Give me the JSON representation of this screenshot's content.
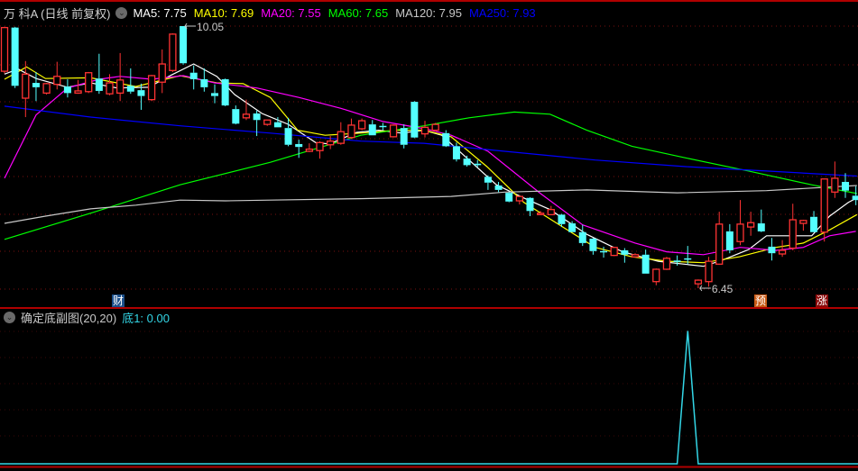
{
  "header": {
    "title": "万 科A (日线 前复权)",
    "ma_items": [
      {
        "label": "MA5: 7.75",
        "color": "#ffffff"
      },
      {
        "label": "MA10: 7.69",
        "color": "#ffff00"
      },
      {
        "label": "MA20: 7.55",
        "color": "#ff00ff"
      },
      {
        "label": "MA60: 7.65",
        "color": "#00ff00"
      },
      {
        "label": "MA120: 7.95",
        "color": "#c8c8c8"
      },
      {
        "label": "MA250: 7.93",
        "color": "#0000ff"
      }
    ]
  },
  "markers": {
    "cai": "财",
    "yu": "预",
    "zhang": "涨"
  },
  "subchart": {
    "title": "确定底副图(20,20)",
    "value_label": "底1: 0.00"
  },
  "chart_data": {
    "type": "candlestick",
    "title": "万科A 日线 前复权",
    "ylim": [
      6.3,
      10.15
    ],
    "up_color": "#ff3333",
    "down_color": "#54ffff",
    "high_label": "10.05",
    "low_label": "6.45",
    "high_index": 17,
    "low_index": 66,
    "candles_ochl": [
      [
        9.43,
        10.03,
        10.04,
        9.4
      ],
      [
        10.03,
        9.23,
        10.04,
        9.2
      ],
      [
        9.06,
        9.39,
        9.57,
        8.8
      ],
      [
        9.27,
        9.21,
        9.42,
        9.02
      ],
      [
        9.13,
        9.26,
        9.27,
        9.11
      ],
      [
        9.25,
        9.36,
        9.56,
        9.18
      ],
      [
        9.22,
        9.13,
        9.32,
        9.07
      ],
      [
        9.13,
        9.16,
        9.31,
        9.12
      ],
      [
        9.15,
        9.41,
        9.42,
        9.13
      ],
      [
        9.33,
        9.16,
        9.67,
        9.12
      ],
      [
        9.12,
        9.27,
        9.39,
        9.1
      ],
      [
        9.13,
        9.31,
        9.68,
        9.02
      ],
      [
        9.23,
        9.15,
        9.47,
        9.12
      ],
      [
        9.17,
        9.09,
        9.26,
        8.9
      ],
      [
        9.04,
        9.37,
        9.38,
        9.02
      ],
      [
        9.28,
        9.53,
        9.73,
        9.13
      ],
      [
        9.44,
        9.94,
        9.95,
        9.42
      ],
      [
        10.05,
        9.54,
        10.05,
        9.52
      ],
      [
        9.41,
        9.32,
        9.51,
        9.18
      ],
      [
        9.32,
        9.21,
        9.47,
        9.15
      ],
      [
        9.13,
        9.09,
        9.25,
        8.99
      ],
      [
        9.32,
        8.96,
        9.33,
        8.95
      ],
      [
        8.91,
        8.71,
        8.96,
        8.7
      ],
      [
        8.79,
        8.84,
        9.04,
        8.76
      ],
      [
        8.85,
        8.76,
        8.89,
        8.54
      ],
      [
        8.7,
        8.76,
        8.76,
        8.68
      ],
      [
        8.73,
        8.66,
        8.8,
        8.66
      ],
      [
        8.65,
        8.42,
        8.79,
        8.4
      ],
      [
        8.43,
        8.39,
        8.49,
        8.24
      ],
      [
        8.33,
        8.36,
        8.44,
        8.32
      ],
      [
        8.34,
        8.45,
        8.47,
        8.23
      ],
      [
        8.42,
        8.47,
        8.54,
        8.36
      ],
      [
        8.44,
        8.6,
        8.73,
        8.42
      ],
      [
        8.52,
        8.69,
        8.78,
        8.5
      ],
      [
        8.64,
        8.75,
        8.78,
        8.62
      ],
      [
        8.7,
        8.55,
        8.76,
        8.55
      ],
      [
        8.68,
        8.67,
        8.72,
        8.62
      ],
      [
        8.53,
        8.69,
        8.7,
        8.52
      ],
      [
        8.65,
        8.42,
        8.7,
        8.37
      ],
      [
        9.01,
        8.52,
        9.02,
        8.51
      ],
      [
        8.57,
        8.66,
        8.75,
        8.52
      ],
      [
        8.62,
        8.7,
        8.72,
        8.6
      ],
      [
        8.58,
        8.4,
        8.62,
        8.39
      ],
      [
        8.4,
        8.22,
        8.45,
        8.19
      ],
      [
        8.23,
        8.14,
        8.27,
        8.12
      ],
      [
        8.16,
        8.14,
        8.21,
        8.11
      ],
      [
        7.98,
        7.9,
        8.0,
        7.8
      ],
      [
        7.86,
        7.8,
        7.91,
        7.77
      ],
      [
        7.76,
        7.64,
        7.77,
        7.63
      ],
      [
        7.65,
        7.71,
        7.72,
        7.6
      ],
      [
        7.69,
        7.51,
        7.7,
        7.44
      ],
      [
        7.46,
        7.48,
        7.51,
        7.46
      ],
      [
        7.46,
        7.53,
        7.58,
        7.46
      ],
      [
        7.46,
        7.33,
        7.47,
        7.29
      ],
      [
        7.34,
        7.22,
        7.37,
        7.22
      ],
      [
        7.22,
        7.07,
        7.32,
        7.03
      ],
      [
        7.13,
        6.96,
        7.14,
        6.91
      ],
      [
        6.96,
        6.95,
        7.02,
        6.87
      ],
      [
        6.9,
        7.01,
        7.02,
        6.89
      ],
      [
        6.97,
        6.91,
        7.0,
        6.8
      ],
      [
        6.88,
        6.91,
        6.93,
        6.87
      ],
      [
        6.91,
        6.65,
        6.98,
        6.65
      ],
      [
        6.54,
        6.71,
        6.72,
        6.49
      ],
      [
        6.71,
        6.86,
        6.88,
        6.7
      ],
      [
        6.83,
        6.81,
        6.9,
        6.76
      ],
      [
        6.86,
        6.85,
        7.03,
        6.78
      ],
      [
        6.51,
        6.56,
        6.57,
        6.45
      ],
      [
        6.54,
        6.82,
        6.88,
        6.47
      ],
      [
        6.78,
        7.33,
        7.5,
        6.77
      ],
      [
        7.23,
        6.97,
        7.33,
        6.93
      ],
      [
        7.09,
        7.33,
        7.66,
        7.04
      ],
      [
        7.29,
        7.35,
        7.5,
        7.17
      ],
      [
        7.34,
        7.23,
        7.53,
        7.22
      ],
      [
        7.02,
        6.93,
        7.14,
        6.83
      ],
      [
        6.92,
        6.97,
        7.11,
        6.88
      ],
      [
        7.0,
        7.39,
        7.61,
        6.97
      ],
      [
        7.34,
        7.38,
        7.39,
        7.24
      ],
      [
        7.43,
        7.22,
        7.51,
        7.22
      ],
      [
        7.22,
        7.95,
        7.95,
        7.09
      ],
      [
        7.77,
        7.96,
        8.19,
        7.69
      ],
      [
        7.91,
        7.79,
        8.03,
        7.69
      ],
      [
        7.72,
        7.66,
        7.85,
        7.59
      ]
    ],
    "ma_series": [
      {
        "name": "MA5",
        "color": "#ffffff",
        "points": [
          [
            0,
            9.39
          ],
          [
            1.3,
            9.46
          ],
          [
            3,
            9.33
          ],
          [
            6,
            9.21
          ],
          [
            8.2,
            9.27
          ],
          [
            10.7,
            9.2
          ],
          [
            13.7,
            9.21
          ],
          [
            15.9,
            9.38
          ],
          [
            18,
            9.53
          ],
          [
            20.2,
            9.36
          ],
          [
            21.9,
            9.11
          ],
          [
            24.5,
            8.85
          ],
          [
            27,
            8.7
          ],
          [
            29.6,
            8.45
          ],
          [
            30.9,
            8.43
          ],
          [
            33.5,
            8.59
          ],
          [
            35.6,
            8.62
          ],
          [
            37.8,
            8.58
          ],
          [
            39.9,
            8.62
          ],
          [
            41.6,
            8.55
          ],
          [
            44.2,
            8.21
          ],
          [
            46.8,
            7.87
          ],
          [
            49.4,
            7.69
          ],
          [
            51.9,
            7.53
          ],
          [
            55.4,
            7.19
          ],
          [
            58.8,
            6.95
          ],
          [
            62.2,
            6.82
          ],
          [
            66.5,
            6.75
          ],
          [
            68.2,
            6.83
          ],
          [
            70.8,
            6.98
          ],
          [
            72.5,
            7.17
          ],
          [
            74.7,
            7.17
          ],
          [
            76.8,
            7.17
          ],
          [
            78.5,
            7.44
          ],
          [
            80.3,
            7.63
          ],
          [
            81.1,
            7.69
          ]
        ]
      },
      {
        "name": "MA10",
        "color": "#ffff00",
        "points": [
          [
            0,
            9.32
          ],
          [
            2.1,
            9.49
          ],
          [
            3.9,
            9.33
          ],
          [
            8.2,
            9.34
          ],
          [
            12.5,
            9.22
          ],
          [
            16.7,
            9.37
          ],
          [
            20.2,
            9.27
          ],
          [
            22.7,
            9.26
          ],
          [
            25.3,
            9.07
          ],
          [
            27.9,
            8.62
          ],
          [
            30.5,
            8.55
          ],
          [
            33.9,
            8.58
          ],
          [
            37.3,
            8.62
          ],
          [
            39.9,
            8.62
          ],
          [
            42.5,
            8.53
          ],
          [
            45.9,
            8.12
          ],
          [
            49.4,
            7.63
          ],
          [
            52.8,
            7.32
          ],
          [
            56.2,
            7.01
          ],
          [
            59.7,
            6.88
          ],
          [
            63.1,
            6.82
          ],
          [
            66.5,
            6.8
          ],
          [
            69.9,
            6.88
          ],
          [
            73.4,
            7.01
          ],
          [
            76,
            7.07
          ],
          [
            78.5,
            7.25
          ],
          [
            81.1,
            7.46
          ]
        ]
      },
      {
        "name": "MA20",
        "color": "#ff00ff",
        "points": [
          [
            0,
            7.96
          ],
          [
            3,
            8.83
          ],
          [
            6,
            9.2
          ],
          [
            9,
            9.32
          ],
          [
            11,
            9.36
          ],
          [
            14,
            9.32
          ],
          [
            17,
            9.37
          ],
          [
            20,
            9.27
          ],
          [
            24,
            9.2
          ],
          [
            28,
            9.07
          ],
          [
            32,
            8.92
          ],
          [
            36,
            8.74
          ],
          [
            40,
            8.64
          ],
          [
            42.5,
            8.55
          ],
          [
            46,
            8.33
          ],
          [
            51,
            7.75
          ],
          [
            55,
            7.32
          ],
          [
            60,
            7.07
          ],
          [
            63,
            6.95
          ],
          [
            66.5,
            6.91
          ],
          [
            70,
            7.01
          ],
          [
            73.4,
            6.97
          ],
          [
            76,
            7.01
          ],
          [
            78.5,
            7.17
          ],
          [
            81,
            7.23
          ]
        ]
      },
      {
        "name": "MA60",
        "color": "#00ff00",
        "points": [
          [
            0,
            7.12
          ],
          [
            8.2,
            7.48
          ],
          [
            16.7,
            7.87
          ],
          [
            25.3,
            8.18
          ],
          [
            33.9,
            8.55
          ],
          [
            39.9,
            8.68
          ],
          [
            44.2,
            8.79
          ],
          [
            48.5,
            8.87
          ],
          [
            51.9,
            8.84
          ],
          [
            55.4,
            8.62
          ],
          [
            59.7,
            8.4
          ],
          [
            64.8,
            8.24
          ],
          [
            70.8,
            8.06
          ],
          [
            76.8,
            7.87
          ],
          [
            81.1,
            7.75
          ]
        ]
      },
      {
        "name": "MA120",
        "color": "#c8c8c8",
        "points": [
          [
            0,
            7.34
          ],
          [
            3.9,
            7.44
          ],
          [
            8.2,
            7.54
          ],
          [
            12.5,
            7.59
          ],
          [
            16.7,
            7.66
          ],
          [
            21,
            7.65
          ],
          [
            25.3,
            7.66
          ],
          [
            33.9,
            7.68
          ],
          [
            42.5,
            7.71
          ],
          [
            47.6,
            7.77
          ],
          [
            55.4,
            7.8
          ],
          [
            64,
            7.76
          ],
          [
            72.5,
            7.79
          ],
          [
            81.1,
            7.86
          ]
        ]
      },
      {
        "name": "MA250",
        "color": "#0000ff",
        "points": [
          [
            0,
            8.95
          ],
          [
            8.2,
            8.8
          ],
          [
            16.7,
            8.68
          ],
          [
            25.3,
            8.58
          ],
          [
            33.9,
            8.47
          ],
          [
            39.9,
            8.44
          ],
          [
            47.6,
            8.33
          ],
          [
            56.2,
            8.21
          ],
          [
            64.8,
            8.12
          ],
          [
            72.5,
            8.06
          ],
          [
            81.1,
            7.99
          ]
        ]
      }
    ],
    "sub_series": {
      "name": "底1",
      "color": "#33d6e6",
      "spike_index": 65,
      "spike_value": 1,
      "ylim": [
        0,
        1.05
      ]
    }
  }
}
